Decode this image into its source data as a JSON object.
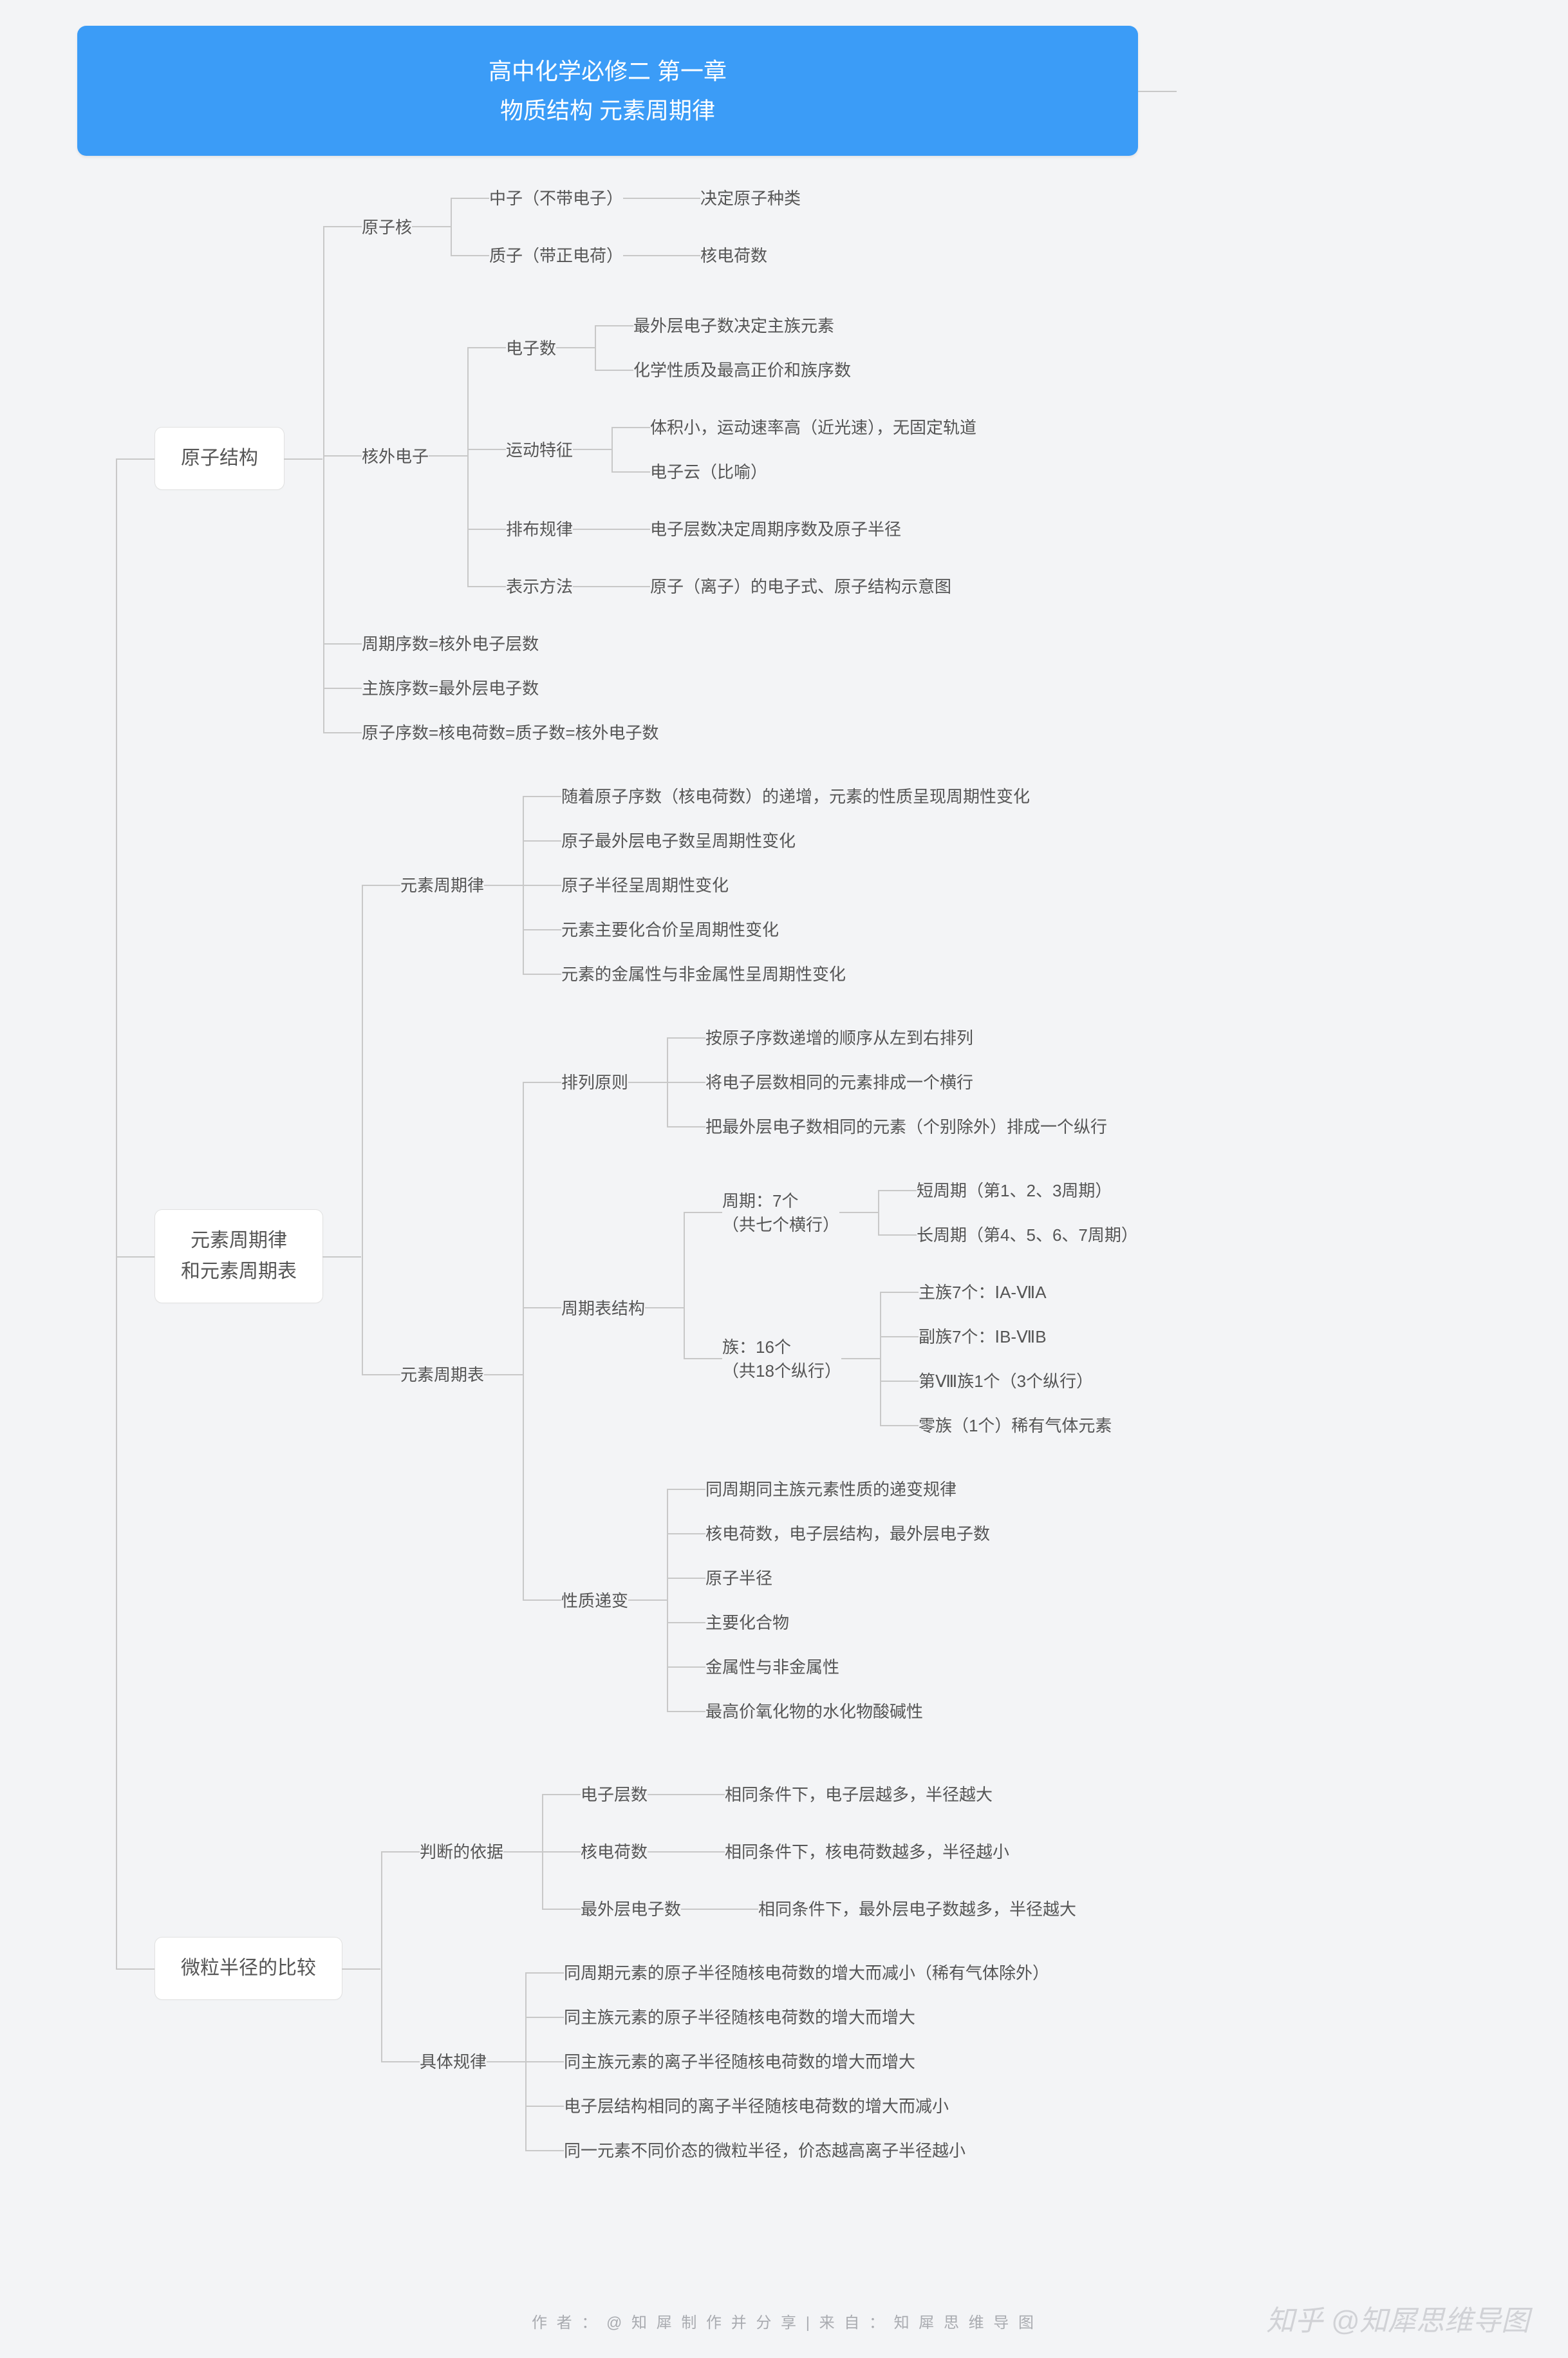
{
  "footer": "作 者 ： @ 知 犀 制 作 并 分 享   |   来 自 ： 知 犀 思 维 导 图",
  "watermark": "知乎 @知犀思维导图",
  "tree": {
    "label": "高中化学必修二 第一章\n物质结构 元素周期律",
    "style": "root",
    "children": [
      {
        "label": "原子结构",
        "style": "boxed",
        "children": [
          {
            "label": "原子核",
            "children": [
              {
                "label": "中子（不带电子）",
                "children": [
                  {
                    "label": "决定原子种类"
                  }
                ]
              },
              {
                "label": "质子（带正电荷）",
                "children": [
                  {
                    "label": "核电荷数"
                  }
                ]
              }
            ]
          },
          {
            "label": "核外电子",
            "children": [
              {
                "label": "电子数",
                "children": [
                  {
                    "label": "最外层电子数决定主族元素"
                  },
                  {
                    "label": "化学性质及最高正价和族序数"
                  }
                ]
              },
              {
                "label": "运动特征",
                "children": [
                  {
                    "label": "体积小，运动速率高（近光速），无固定轨道"
                  },
                  {
                    "label": "电子云（比喻）"
                  }
                ]
              },
              {
                "label": "排布规律",
                "children": [
                  {
                    "label": "电子层数决定周期序数及原子半径"
                  }
                ]
              },
              {
                "label": "表示方法",
                "children": [
                  {
                    "label": "原子（离子）的电子式、原子结构示意图"
                  }
                ]
              }
            ]
          },
          {
            "label": "周期序数=核外电子层数"
          },
          {
            "label": "主族序数=最外层电子数"
          },
          {
            "label": "原子序数=核电荷数=质子数=核外电子数"
          }
        ]
      },
      {
        "label": "元素周期律\n和元素周期表",
        "style": "boxed",
        "children": [
          {
            "label": "元素周期律",
            "children": [
              {
                "label": "随着原子序数（核电荷数）的递增，元素的性质呈现周期性变化"
              },
              {
                "label": "原子最外层电子数呈周期性变化"
              },
              {
                "label": "原子半径呈周期性变化"
              },
              {
                "label": "元素主要化合价呈周期性变化"
              },
              {
                "label": "元素的金属性与非金属性呈周期性变化"
              }
            ]
          },
          {
            "label": "元素周期表",
            "children": [
              {
                "label": "排列原则",
                "children": [
                  {
                    "label": "按原子序数递增的顺序从左到右排列"
                  },
                  {
                    "label": "将电子层数相同的元素排成一个横行"
                  },
                  {
                    "label": "把最外层电子数相同的元素（个别除外）排成一个纵行"
                  }
                ]
              },
              {
                "label": "周期表结构",
                "children": [
                  {
                    "label": "周期：7个\n（共七个横行）",
                    "children": [
                      {
                        "label": "短周期（第1、2、3周期）"
                      },
                      {
                        "label": "长周期（第4、5、6、7周期）"
                      }
                    ]
                  },
                  {
                    "label": "族：16个\n（共18个纵行）",
                    "children": [
                      {
                        "label": "主族7个：ⅠA-ⅦA"
                      },
                      {
                        "label": "副族7个：ⅠB-ⅦB"
                      },
                      {
                        "label": "第Ⅷ族1个（3个纵行）"
                      },
                      {
                        "label": "零族（1个）稀有气体元素"
                      }
                    ]
                  }
                ]
              },
              {
                "label": "性质递变",
                "children": [
                  {
                    "label": "同周期同主族元素性质的递变规律"
                  },
                  {
                    "label": "核电荷数，电子层结构，最外层电子数"
                  },
                  {
                    "label": "原子半径"
                  },
                  {
                    "label": "主要化合物"
                  },
                  {
                    "label": "金属性与非金属性"
                  },
                  {
                    "label": "最高价氧化物的水化物酸碱性"
                  }
                ]
              }
            ]
          }
        ]
      },
      {
        "label": "微粒半径的比较",
        "style": "boxed",
        "children": [
          {
            "label": "判断的依据",
            "children": [
              {
                "label": "电子层数",
                "children": [
                  {
                    "label": "相同条件下，电子层越多，半径越大"
                  }
                ]
              },
              {
                "label": "核电荷数",
                "children": [
                  {
                    "label": "相同条件下，核电荷数越多，半径越小"
                  }
                ]
              },
              {
                "label": "最外层电子数",
                "children": [
                  {
                    "label": "相同条件下，最外层电子数越多，半径越大"
                  }
                ]
              }
            ]
          },
          {
            "label": "具体规律",
            "children": [
              {
                "label": "同周期元素的原子半径随核电荷数的增大而减小（稀有气体除外）"
              },
              {
                "label": "同主族元素的原子半径随核电荷数的增大而增大"
              },
              {
                "label": "同主族元素的离子半径随核电荷数的增大而增大"
              },
              {
                "label": "电子层结构相同的离子半径随核电荷数的增大而减小"
              },
              {
                "label": "同一元素不同价态的微粒半径，价态越高离子半径越小"
              }
            ]
          }
        ]
      }
    ]
  }
}
